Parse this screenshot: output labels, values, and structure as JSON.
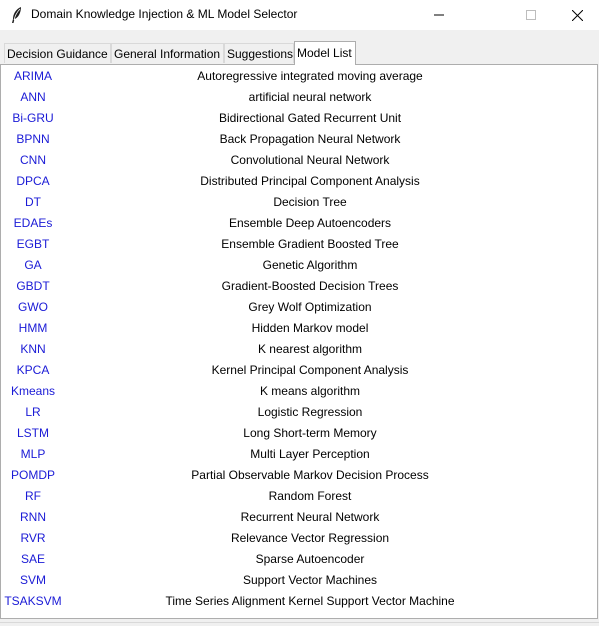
{
  "window": {
    "title": "Domain Knowledge Injection & ML Model Selector",
    "icon": "feather-icon"
  },
  "tabs": [
    {
      "label": "Decision Guidance",
      "active": false
    },
    {
      "label": "General Information",
      "active": false
    },
    {
      "label": "Suggestions",
      "active": false
    },
    {
      "label": "Model List",
      "active": true
    }
  ],
  "colors": {
    "abbr_text": "#1a1ad6",
    "full_text": "#000000"
  },
  "models": [
    {
      "abbr": "ARIMA",
      "full": "Autoregressive integrated moving average"
    },
    {
      "abbr": "ANN",
      "full": "artificial neural network"
    },
    {
      "abbr": "Bi-GRU",
      "full": "Bidirectional Gated Recurrent Unit"
    },
    {
      "abbr": "BPNN",
      "full": "Back Propagation Neural Network"
    },
    {
      "abbr": "CNN",
      "full": "Convolutional Neural Network"
    },
    {
      "abbr": "DPCA",
      "full": "Distributed Principal Component Analysis"
    },
    {
      "abbr": "DT",
      "full": "Decision Tree"
    },
    {
      "abbr": "EDAEs",
      "full": "Ensemble Deep Autoencoders"
    },
    {
      "abbr": "EGBT",
      "full": "Ensemble Gradient Boosted Tree"
    },
    {
      "abbr": "GA",
      "full": "Genetic Algorithm"
    },
    {
      "abbr": "GBDT",
      "full": "Gradient-Boosted Decision Trees"
    },
    {
      "abbr": "GWO",
      "full": "Grey Wolf Optimization"
    },
    {
      "abbr": "HMM",
      "full": "Hidden Markov model"
    },
    {
      "abbr": "KNN",
      "full": "K nearest algorithm"
    },
    {
      "abbr": "KPCA",
      "full": "Kernel Principal Component Analysis"
    },
    {
      "abbr": "Kmeans",
      "full": "K means algorithm"
    },
    {
      "abbr": "LR",
      "full": "Logistic Regression"
    },
    {
      "abbr": "LSTM",
      "full": "Long Short-term Memory"
    },
    {
      "abbr": "MLP",
      "full": "Multi Layer Perception"
    },
    {
      "abbr": "POMDP",
      "full": "Partial Observable Markov Decision Process"
    },
    {
      "abbr": "RF",
      "full": "Random Forest"
    },
    {
      "abbr": "RNN",
      "full": "Recurrent Neural Network"
    },
    {
      "abbr": "RVR",
      "full": "Relevance Vector Regression"
    },
    {
      "abbr": "SAE",
      "full": "Sparse Autoencoder"
    },
    {
      "abbr": "SVM",
      "full": "Support Vector Machines"
    },
    {
      "abbr": "TSAKSVM",
      "full": "Time Series Alignment Kernel Support Vector Machine"
    }
  ]
}
